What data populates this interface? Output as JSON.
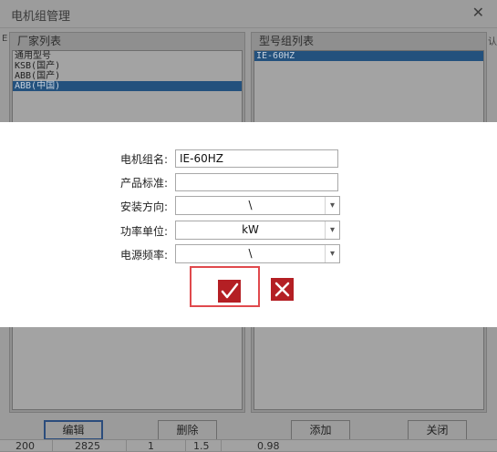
{
  "window": {
    "title": "电机组管理",
    "edge_left": "E",
    "edge_right": "认"
  },
  "vendor_panel": {
    "header": "厂家列表",
    "items": [
      {
        "label": "通用型号",
        "selected": false
      },
      {
        "label": "KSB(国产)",
        "selected": false
      },
      {
        "label": "ABB(国产)",
        "selected": false
      },
      {
        "label": "ABB(中国)",
        "selected": true
      }
    ]
  },
  "model_panel": {
    "header": "型号组列表",
    "items": [
      {
        "label": "IE-60HZ",
        "selected": true
      }
    ]
  },
  "bottom_buttons": {
    "edit": "编辑",
    "delete": "删除",
    "add": "添加",
    "close": "关闭"
  },
  "grid_row": [
    "200",
    "2825",
    "1",
    "1.5",
    "0.98"
  ],
  "dialog": {
    "fields": {
      "group_name": {
        "label": "电机组名:",
        "value": "IE-60HZ"
      },
      "product_standard": {
        "label": "产品标准:",
        "value": ""
      },
      "install_direction": {
        "label": "安装方向:",
        "value": "\\"
      },
      "power_unit": {
        "label": "功率单位:",
        "value": "kW"
      },
      "power_frequency": {
        "label": "电源频率:",
        "value": "\\"
      }
    },
    "confirm_icon": "checkmark-icon",
    "cancel_icon": "close-x-icon",
    "accent_color": "#b41f24",
    "highlight_color": "#e0494d"
  }
}
